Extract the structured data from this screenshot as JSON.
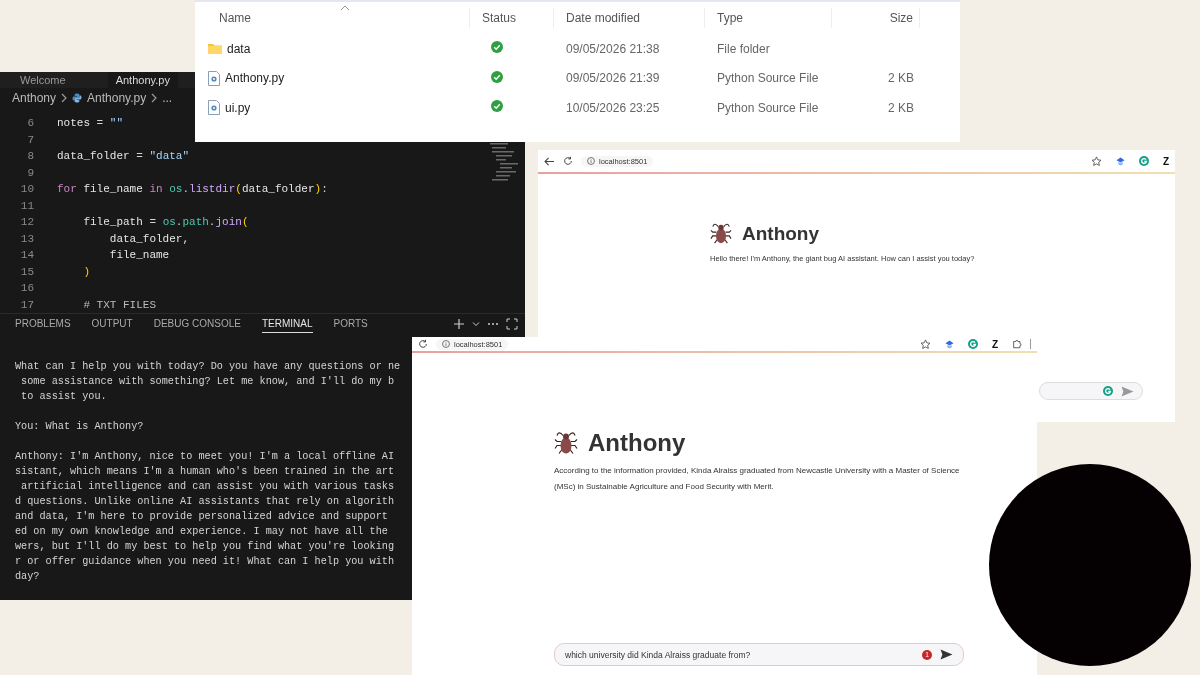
{
  "file_explorer": {
    "columns": [
      "Name",
      "Status",
      "Date modified",
      "Type",
      "Size"
    ],
    "rows": [
      {
        "kind": "folder",
        "name": "data",
        "date": "09/05/2026 21:38",
        "type": "File folder"
      },
      {
        "kind": "python",
        "name": "Anthony.py",
        "date": "09/05/2026 21:39",
        "type": "Python Source File",
        "size": "2 KB"
      },
      {
        "kind": "python",
        "name": "ui.py",
        "date": "10/05/2026 23:25",
        "type": "Python Source File",
        "size": "2 KB"
      }
    ]
  },
  "editor": {
    "tabs": [
      {
        "label": "Welcome",
        "selected": false
      },
      {
        "label": "Anthony.py",
        "selected": true
      }
    ],
    "breadcrumb": [
      "Anthony",
      "Anthony.py",
      "..."
    ],
    "code_lines": [
      {
        "number": "6",
        "tokens": [
          {
            "text": "notes",
            "kind": "var"
          },
          {
            "text": " = ",
            "kind": "op"
          },
          {
            "text": "\"\"",
            "kind": "string"
          }
        ]
      },
      {
        "number": "7"
      },
      {
        "number": "8",
        "tokens": [
          {
            "text": "data_folder",
            "kind": "var"
          },
          {
            "text": " = ",
            "kind": "op"
          },
          {
            "text": "\"data\"",
            "kind": "string"
          }
        ]
      },
      {
        "number": "9"
      },
      {
        "number": "10",
        "tokens": [
          {
            "text": "for",
            "kind": "keyword"
          },
          {
            "text": " file_name ",
            "kind": "var"
          },
          {
            "text": "in",
            "kind": "keyword"
          },
          {
            "text": " os",
            "kind": "module"
          },
          {
            "text": ".",
            "kind": "op"
          },
          {
            "text": "listdir",
            "kind": "func"
          },
          {
            "text": "(",
            "kind": "paren"
          },
          {
            "text": "data_folder",
            "kind": "var"
          },
          {
            "text": ")",
            "kind": "paren"
          },
          {
            "text": ":",
            "kind": "op"
          }
        ]
      },
      {
        "number": "11"
      },
      {
        "number": "12",
        "tokens": [
          {
            "text": "    file_path",
            "kind": "var"
          },
          {
            "text": " = ",
            "kind": "op"
          },
          {
            "text": "os",
            "kind": "module"
          },
          {
            "text": ".",
            "kind": "op"
          },
          {
            "text": "path",
            "kind": "module"
          },
          {
            "text": ".",
            "kind": "op"
          },
          {
            "text": "join",
            "kind": "func"
          },
          {
            "text": "(",
            "kind": "paren"
          }
        ]
      },
      {
        "number": "13",
        "tokens": [
          {
            "text": "        data_folder,",
            "kind": "var"
          }
        ]
      },
      {
        "number": "14",
        "tokens": [
          {
            "text": "        file_name",
            "kind": "var"
          }
        ]
      },
      {
        "number": "15",
        "tokens": [
          {
            "text": "    )",
            "kind": "paren"
          }
        ]
      },
      {
        "number": "16"
      },
      {
        "number": "17",
        "tokens": [
          {
            "text": "    # TXT FILES",
            "kind": "comment"
          }
        ]
      }
    ],
    "panel_tabs": [
      {
        "label": "PROBLEMS",
        "selected": false
      },
      {
        "label": "OUTPUT",
        "selected": false
      },
      {
        "label": "DEBUG CONSOLE",
        "selected": false
      },
      {
        "label": "TERMINAL",
        "selected": true
      },
      {
        "label": "PORTS",
        "selected": false
      }
    ],
    "terminal": [
      [
        "What can I help you with today? Do you have any questions or ne",
        " some assistance with something? Let me know, and I'll do my b",
        " to assist you."
      ],
      [
        "You: What is Anthony?"
      ],
      [
        "Anthony: I'm Anthony, nice to meet you! I'm a local offline AI",
        "sistant, which means I'm a human who's been trained in the art",
        " artificial intelligence and can assist you with various tasks",
        "d questions. Unlike online AI assistants that rely on algorith",
        "and data, I'm here to provide personalized advice and support",
        "ed on my own knowledge and experience. I may not have all the",
        "wers, but I'll do my best to help you find what you're looking",
        "r or offer guidance when you need it! What can I help you with",
        "day?"
      ]
    ]
  },
  "browsers": [
    {
      "back_button": true,
      "url": "localhost:8501",
      "extensions": [
        {
          "kind": "shield"
        },
        {
          "kind": "grammarly"
        },
        {
          "kind": "letter",
          "text": "Z"
        }
      ],
      "title": "Anthony",
      "message": "Hello there! I'm Anthony, the giant bug AI assistant. How can I assist you today?",
      "input": {
        "grammarly": true
      }
    },
    {
      "back_button": false,
      "url": "localhost:8501",
      "extensions": [
        {
          "kind": "shield"
        },
        {
          "kind": "grammarly"
        },
        {
          "kind": "letter",
          "text": "Z"
        },
        {
          "kind": "puzzle"
        }
      ],
      "title": "Anthony",
      "message": "According to the information provided, Kinda Alraiss graduated from Newcastle University with a Master of Science (MSc) in Sustainable Agriculture and Food Security with Merit.",
      "input": {
        "value": "which university did Kinda Alraiss graduate from?",
        "badge": "1"
      }
    }
  ]
}
